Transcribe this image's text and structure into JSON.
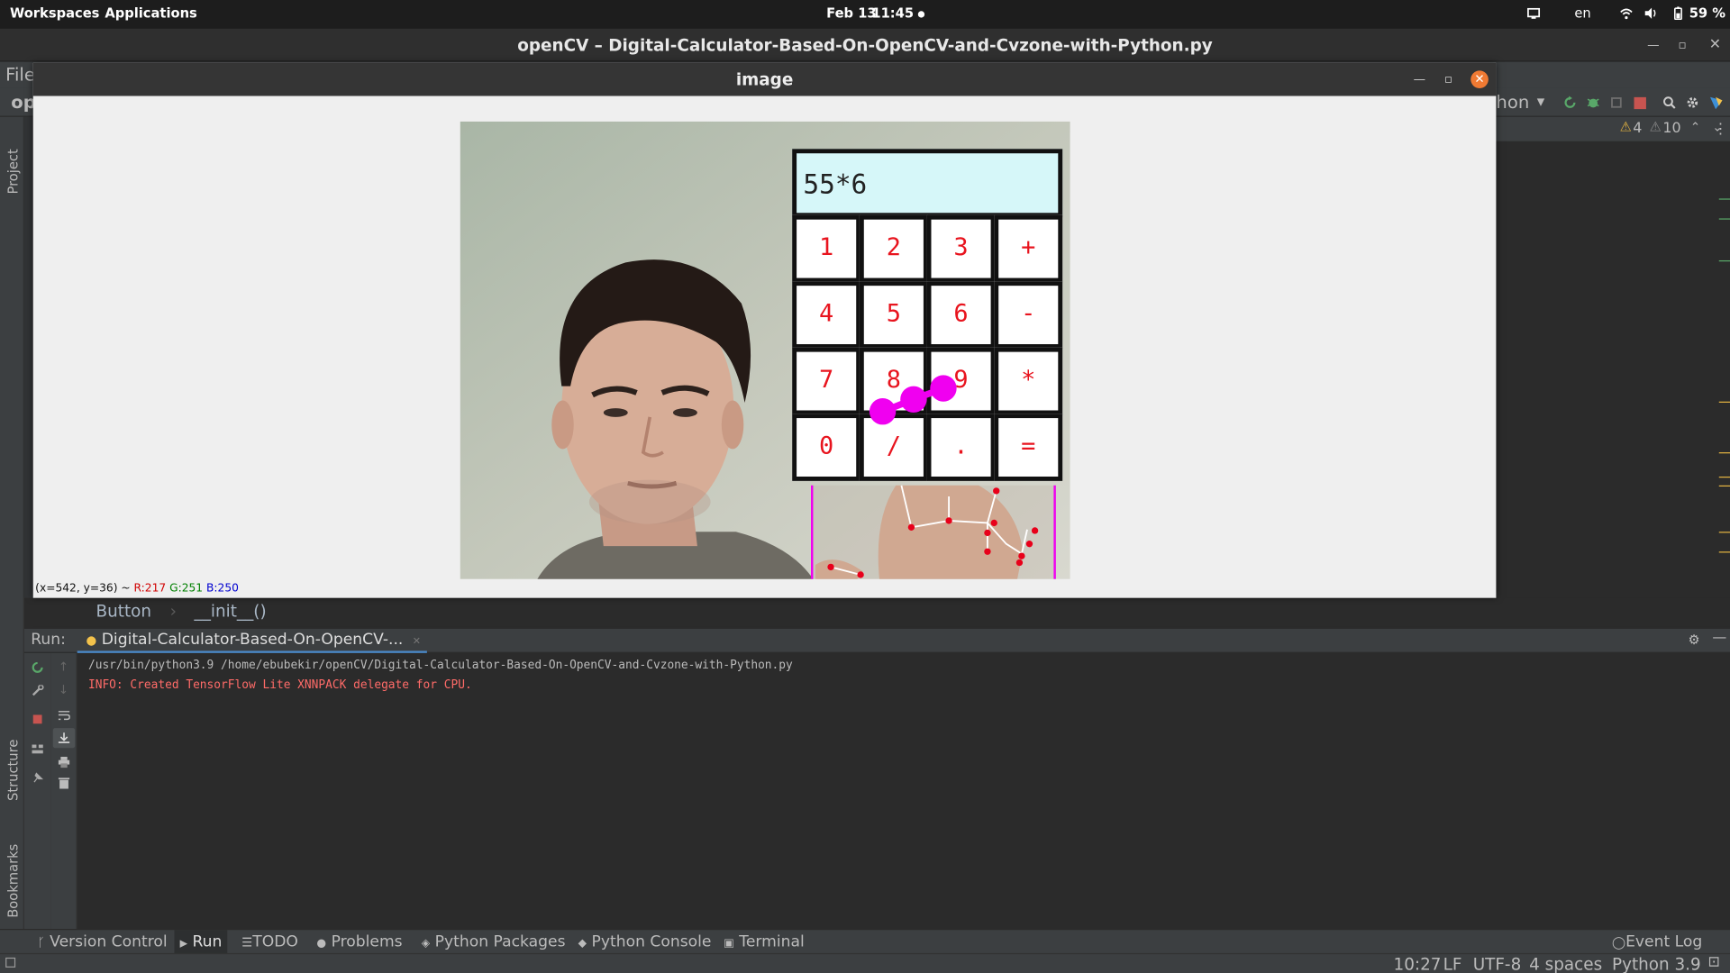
{
  "topbar": {
    "workspaces": "Workspaces",
    "applications": "Applications",
    "date": "Feb 13",
    "time": "11:45",
    "language": "en",
    "battery": "59 %"
  },
  "ide_window": {
    "title": "openCV – Digital-Calculator-Based-On-OpenCV-and-Cvzone-with-Python.py",
    "menu_first": "File",
    "project_abbrev": "op",
    "run_config_fragment": "hon",
    "warnings_count": "4",
    "weak_warnings_count": "10"
  },
  "side_tabs": {
    "project": "Project",
    "structure": "Structure",
    "bookmarks": "Bookmarks"
  },
  "breadcrumb": {
    "class": "Button",
    "method": "__init__()"
  },
  "run_panel": {
    "label": "Run:",
    "tab": "Digital-Calculator-Based-On-OpenCV-...",
    "console_lines": [
      "/usr/bin/python3.9 /home/ebubekir/openCV/Digital-Calculator-Based-On-OpenCV-and-Cvzone-with-Python.py",
      "INFO: Created TensorFlow Lite XNNPACK delegate for CPU."
    ]
  },
  "tool_windows": [
    {
      "label": "Version Control",
      "icon": "version-control-icon"
    },
    {
      "label": "Run",
      "icon": "run-icon"
    },
    {
      "label": "TODO",
      "icon": "todo-icon"
    },
    {
      "label": "Problems",
      "icon": "problems-icon"
    },
    {
      "label": "Python Packages",
      "icon": "packages-icon"
    },
    {
      "label": "Python Console",
      "icon": "python-console-icon"
    },
    {
      "label": "Terminal",
      "icon": "terminal-icon"
    }
  ],
  "event_log": "Event Log",
  "status": {
    "position": "10:27",
    "line_sep": "LF",
    "encoding": "UTF-8",
    "indent": "4 spaces",
    "interpreter": "Python 3.9"
  },
  "image_window": {
    "title": "image",
    "pixel_info": {
      "coords": "(x=542, y=36) ~",
      "r": "R:217",
      "g": "G:251",
      "b": "B:250"
    }
  },
  "calculator": {
    "display": "55*6",
    "keys": [
      "1",
      "2",
      "3",
      "+",
      "4",
      "5",
      "6",
      "-",
      "7",
      "8",
      "9",
      "*",
      "0",
      "/",
      ".",
      "="
    ]
  },
  "colors": {
    "accent_orange": "#f07a33",
    "key_text": "#e8141e",
    "display_bg": "#d6f7f9",
    "finger_marker": "#f000f0",
    "console_error": "#ff6b68"
  }
}
